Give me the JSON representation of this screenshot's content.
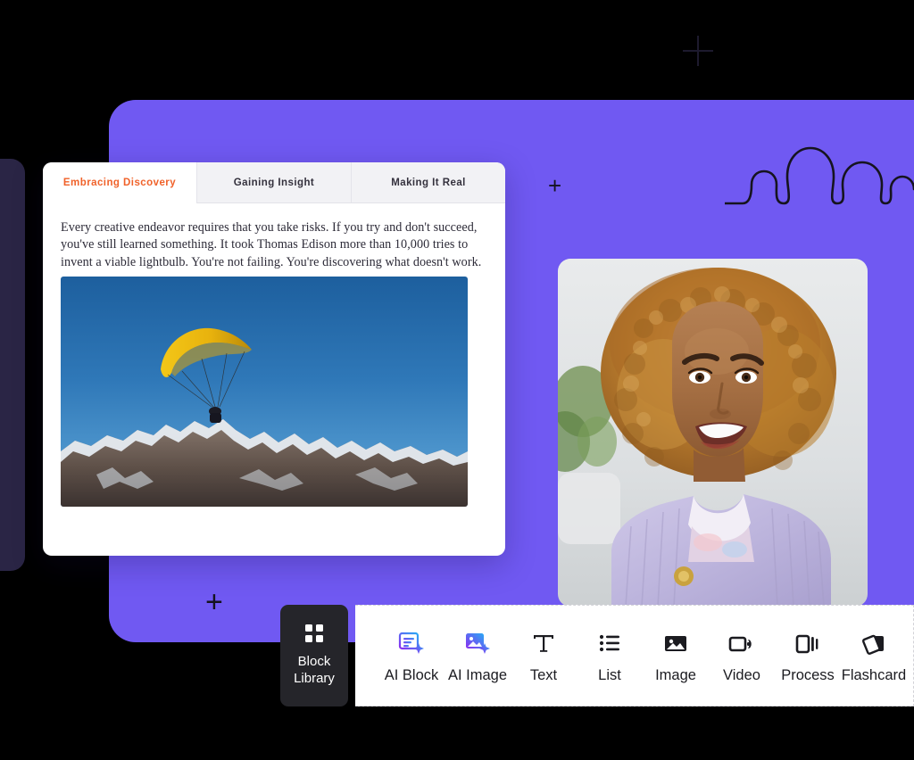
{
  "canvas": {
    "background_color": "#7059f2",
    "decorations": {
      "squiggle": "wavy-line-decoration",
      "plus_marker_top": "+",
      "plus_marker_bottom": "+",
      "crosshair": "crosshair-marker"
    }
  },
  "content_card": {
    "tabs": [
      {
        "label": "Embracing Discovery",
        "active": true
      },
      {
        "label": "Gaining Insight",
        "active": false
      },
      {
        "label": "Making It Real",
        "active": false
      }
    ],
    "active_tab_color": "#f0622a",
    "body_text": "Every creative endeavor requires that you take risks. If you try and don't succeed, you've still learned something. It took Thomas Edison more than 10,000 tries to invent a viable lightbulb. You're not failing. You're discovering what doesn't work.",
    "image": {
      "name": "paraglider-over-snowy-mountains",
      "description": "Yellow paraglider canopy flying in a clear blue sky above a snow-capped mountain range"
    }
  },
  "person_card": {
    "image": {
      "name": "smiling-woman-portrait",
      "description": "Smiling woman with curly blonde-auburn hair wearing a lavender knit cardigan, seated indoors with a plant behind her"
    }
  },
  "block_library": {
    "button_label_line1": "Block",
    "button_label_line2": "Library",
    "button_icon": "grid-2x2-icon",
    "button_background": "#25252a",
    "items": [
      {
        "label": "AI Block",
        "icon": "ai-block-icon",
        "gradient": true
      },
      {
        "label": "AI Image",
        "icon": "ai-image-icon",
        "gradient": true
      },
      {
        "label": "Text",
        "icon": "text-icon",
        "gradient": false
      },
      {
        "label": "List",
        "icon": "list-icon",
        "gradient": false
      },
      {
        "label": "Image",
        "icon": "image-icon",
        "gradient": false
      },
      {
        "label": "Video",
        "icon": "video-icon",
        "gradient": false
      },
      {
        "label": "Process",
        "icon": "process-icon",
        "gradient": false
      },
      {
        "label": "Flashcard",
        "icon": "flashcard-icon",
        "gradient": false
      }
    ],
    "gradient_start": "#8b2df0",
    "gradient_end": "#2aa9f5"
  }
}
